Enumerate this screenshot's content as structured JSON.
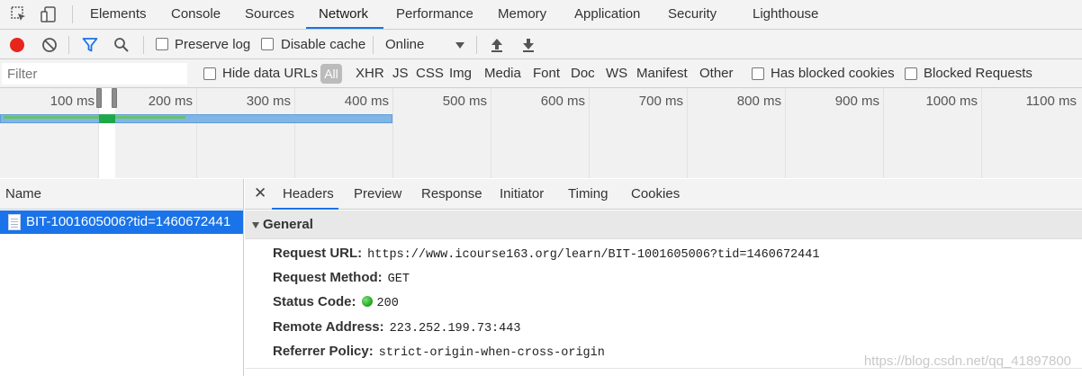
{
  "tabs": [
    "Elements",
    "Console",
    "Sources",
    "Network",
    "Performance",
    "Memory",
    "Application",
    "Security",
    "Lighthouse"
  ],
  "active_tab": "Network",
  "toolbar": {
    "preserve_log": "Preserve log",
    "disable_cache": "Disable cache",
    "throttling": "Online"
  },
  "filter": {
    "placeholder": "Filter",
    "hide_data_urls": "Hide data URLs",
    "all": "All",
    "types": [
      "XHR",
      "JS",
      "CSS",
      "Img",
      "Media",
      "Font",
      "Doc",
      "WS",
      "Manifest",
      "Other"
    ],
    "has_blocked_cookies": "Has blocked cookies",
    "blocked_requests": "Blocked Requests"
  },
  "timeline": {
    "ticks": [
      "100 ms",
      "200 ms",
      "300 ms",
      "400 ms",
      "500 ms",
      "600 ms",
      "700 ms",
      "800 ms",
      "900 ms",
      "1000 ms",
      "1100 ms"
    ]
  },
  "name_column": {
    "header": "Name",
    "requests": [
      "BIT-1001605006?tid=1460672441"
    ]
  },
  "detail": {
    "tabs": [
      "Headers",
      "Preview",
      "Response",
      "Initiator",
      "Timing",
      "Cookies"
    ],
    "active_tab": "Headers",
    "section": "General",
    "rows": [
      {
        "key": "Request URL:",
        "value": "https://www.icourse163.org/learn/BIT-1001605006?tid=1460672441"
      },
      {
        "key": "Request Method:",
        "value": "GET"
      },
      {
        "key": "Status Code:",
        "value": "200"
      },
      {
        "key": "Remote Address:",
        "value": "223.252.199.73:443"
      },
      {
        "key": "Referrer Policy:",
        "value": "strict-origin-when-cross-origin"
      }
    ]
  },
  "watermark": "https://blog.csdn.net/qq_41897800",
  "colors": {
    "accent": "#1a73e8",
    "record": "#e8251c",
    "status_ok": "#1aa31a"
  }
}
